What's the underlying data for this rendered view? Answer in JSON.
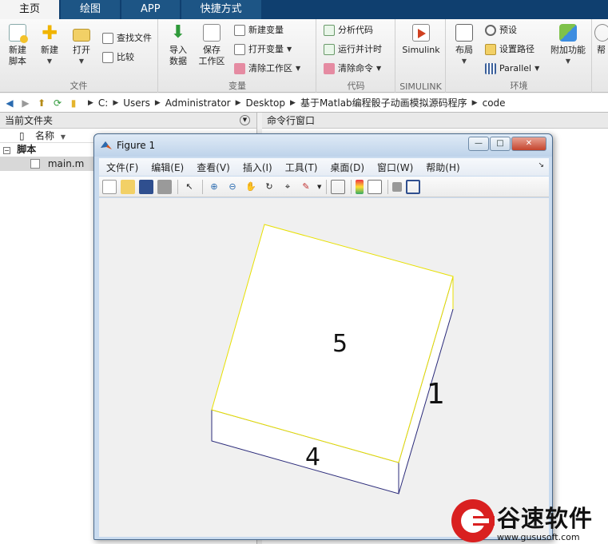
{
  "tabs": [
    {
      "label": "主页",
      "active": true
    },
    {
      "label": "绘图",
      "active": false
    },
    {
      "label": "APP",
      "active": false
    },
    {
      "label": "快捷方式",
      "active": false
    }
  ],
  "ribbon": {
    "file_group": {
      "label": "文件",
      "new_script": "新建\n脚本",
      "new": "新建",
      "open": "打开",
      "find_files": "查找文件",
      "compare": "比较"
    },
    "variable_group": {
      "label": "变量",
      "import_data": "导入\n数据",
      "save_workspace": "保存\n工作区",
      "new_variable": "新建变量",
      "open_variable": "打开变量",
      "clear_workspace": "清除工作区"
    },
    "code_group": {
      "label": "代码",
      "analyze_code": "分析代码",
      "run_and_time": "运行并计时",
      "clear_commands": "清除命令"
    },
    "simulink_group": {
      "label": "SIMULINK",
      "simulink": "Simulink"
    },
    "environment_group": {
      "label": "环境",
      "layout": "布局",
      "preferences": "预设",
      "set_path": "设置路径",
      "parallel": "Parallel",
      "add_ons": "附加功能",
      "help_partial": "帮"
    }
  },
  "address": {
    "crumbs": [
      "C:",
      "Users",
      "Administrator",
      "Desktop",
      "基于Matlab编程骰子动画模拟源码程序",
      "code"
    ]
  },
  "current_folder": {
    "title": "当前文件夹",
    "column_name": "名称",
    "group": "脚本",
    "file": "main.m"
  },
  "command_window": {
    "title": "命令行窗口"
  },
  "figure": {
    "title": "Figure 1",
    "menu": [
      "文件(F)",
      "编辑(E)",
      "查看(V)",
      "插入(I)",
      "工具(T)",
      "桌面(D)",
      "窗口(W)",
      "帮助(H)"
    ],
    "die_faces": {
      "top": "5",
      "right": "1",
      "front": "4"
    },
    "colors": {
      "top_edge": "#e8e000",
      "side_edge": "#2b2b7a",
      "face_fill": "#ffffff"
    }
  },
  "watermark": {
    "brand": "谷速软件",
    "url": "www.gususoft.com"
  }
}
